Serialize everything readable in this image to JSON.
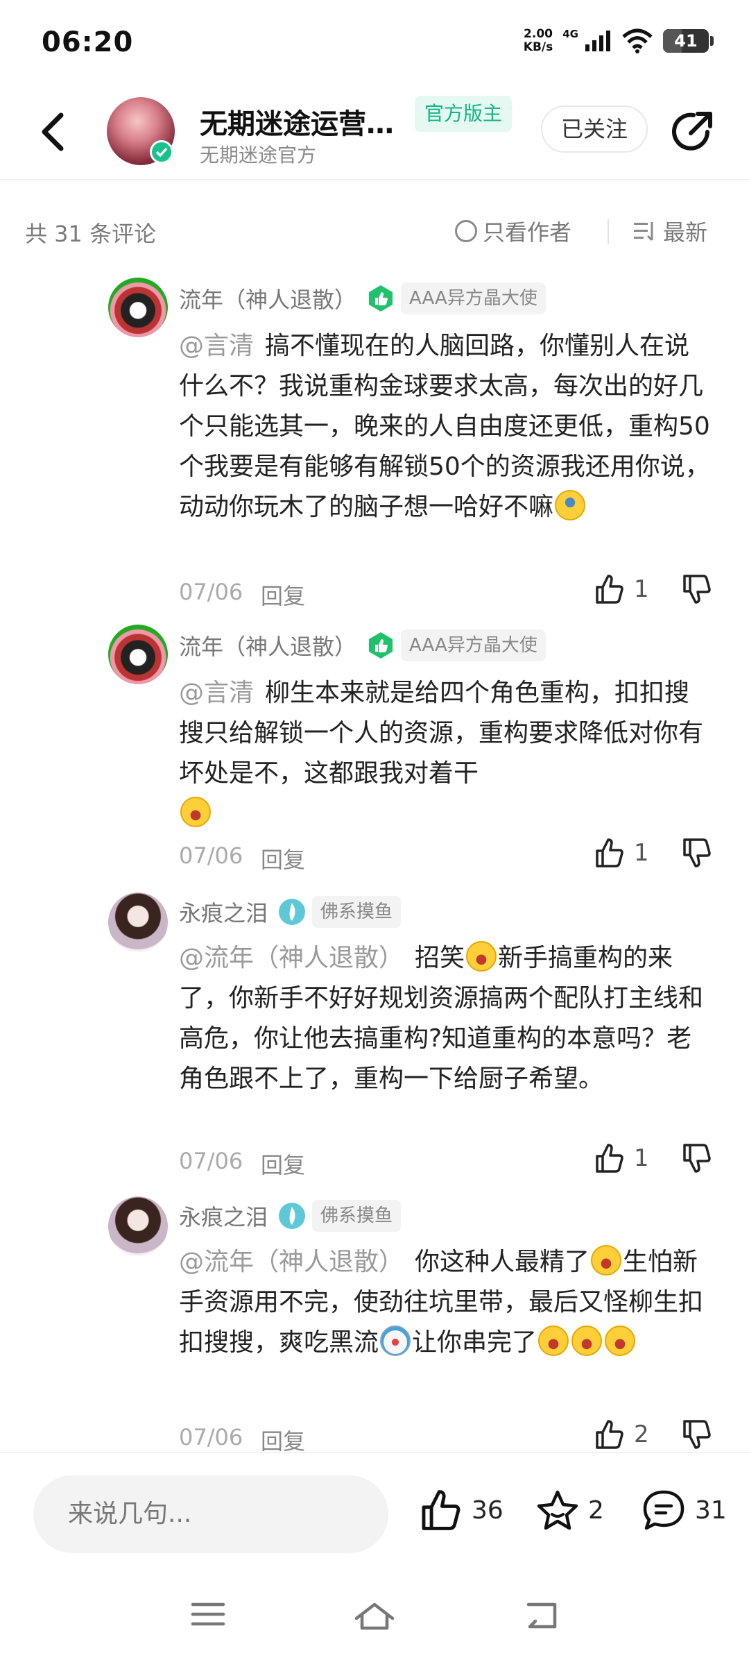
{
  "status_bar": {
    "time": "06:20",
    "net_speed_value": "2.00",
    "net_speed_unit": "KB/s",
    "network": "4G",
    "battery": "41"
  },
  "header": {
    "title": "无期迷途运营…",
    "badge": "官方版主",
    "subtitle": "无期迷途官方",
    "follow_label": "已关注"
  },
  "filters": {
    "count_label": "共 31 条评论",
    "author_only_label": "只看作者",
    "sort_label": "最新"
  },
  "comments": [
    {
      "user": "流年（神人退散）",
      "tag": "AAA异方晶大使",
      "mention": "@言清",
      "text": "搞不懂现在的人脑回路，你懂别人在说什么不？我说重构金球要求太高，每次出的好几个只能选其一，晚来的人自由度还更低，重构50个我要是有能够有解锁50个的资源我还用你说，动动你玩木了的脑子想一哈好不嘛",
      "date": "07/06",
      "reply": "回复",
      "likes": "1"
    },
    {
      "user": "流年（神人退散）",
      "tag": "AAA异方晶大使",
      "mention": "@言清",
      "text": "柳生本来就是给四个角色重构，扣扣搜搜只给解锁一个人的资源，重构要求降低对你有坏处是不，这都跟我对着干",
      "date": "07/06",
      "reply": "回复",
      "likes": "1"
    },
    {
      "user": "永痕之泪",
      "tag": "佛系摸鱼",
      "mention": "@流年（神人退散）",
      "text_a": "招笑",
      "text_b": "新手搞重构的来了，你新手不好好规划资源搞两个配队打主线和高危，你让他去搞重构?知道重构的本意吗？老角色跟不上了，重构一下给厨子希望。",
      "date": "07/06",
      "reply": "回复",
      "likes": "1"
    },
    {
      "user": "永痕之泪",
      "tag": "佛系摸鱼",
      "mention": "@流年（神人退散）",
      "text_a": "你这种人最精了",
      "text_b": "生怕新手资源用不完，使劲往坑里带，最后又怪柳生扣扣搜搜，爽吃黑流",
      "text_c": "让你串完了",
      "date": "07/06",
      "reply": "回复",
      "likes": "2"
    }
  ],
  "bottom_bar": {
    "input_placeholder": "来说几句...",
    "like_count": "36",
    "favorite_count": "2",
    "comment_count": "31"
  },
  "colors": {
    "accent": "#10b482",
    "badge_bg": "#e5f8f2",
    "level_green": "#1fc16b"
  }
}
